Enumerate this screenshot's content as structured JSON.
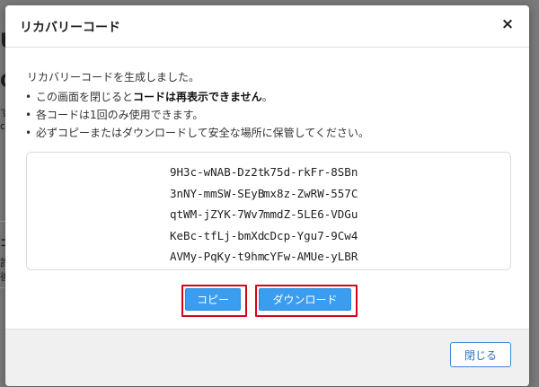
{
  "background": {
    "fragments": [
      "U",
      "C",
      "す",
      "ce",
      "コ",
      "許",
      "後"
    ]
  },
  "modal": {
    "title": "リカバリーコード",
    "close_icon": "×",
    "intro": "リカバリーコードを生成しました。",
    "bullet_char": "•",
    "bullets": {
      "b1_prefix": "この画面を閉じると",
      "b1_bold": "コードは再表示できません",
      "b1_suffix": "。",
      "b2": "各コードは1回のみ使用できます。",
      "b3": "必ずコピーまたはダウンロードして安全な場所に保管してください。"
    },
    "codes": [
      [
        "9H3c-wNAB-Dz2t",
        "k75d-rkFr-8SBn"
      ],
      [
        "3nNY-mmSW-SEyB",
        "mx8z-ZwRW-557C"
      ],
      [
        "qtWM-jZYK-7Wv7",
        "mmdZ-5LE6-VDGu"
      ],
      [
        "KeBc-tfLj-bmXd",
        "cDcp-Ygu7-9Cw4"
      ],
      [
        "AVMy-PqKy-t9hm",
        "cYFw-AMUe-yLBR"
      ]
    ],
    "copy_button": "コピー",
    "download_button": "ダウンロード",
    "footer_close_button": "閉じる"
  },
  "colors": {
    "primary": "#3a9df0",
    "highlight": "#d8001c",
    "footer_button": "#2c74c7"
  }
}
